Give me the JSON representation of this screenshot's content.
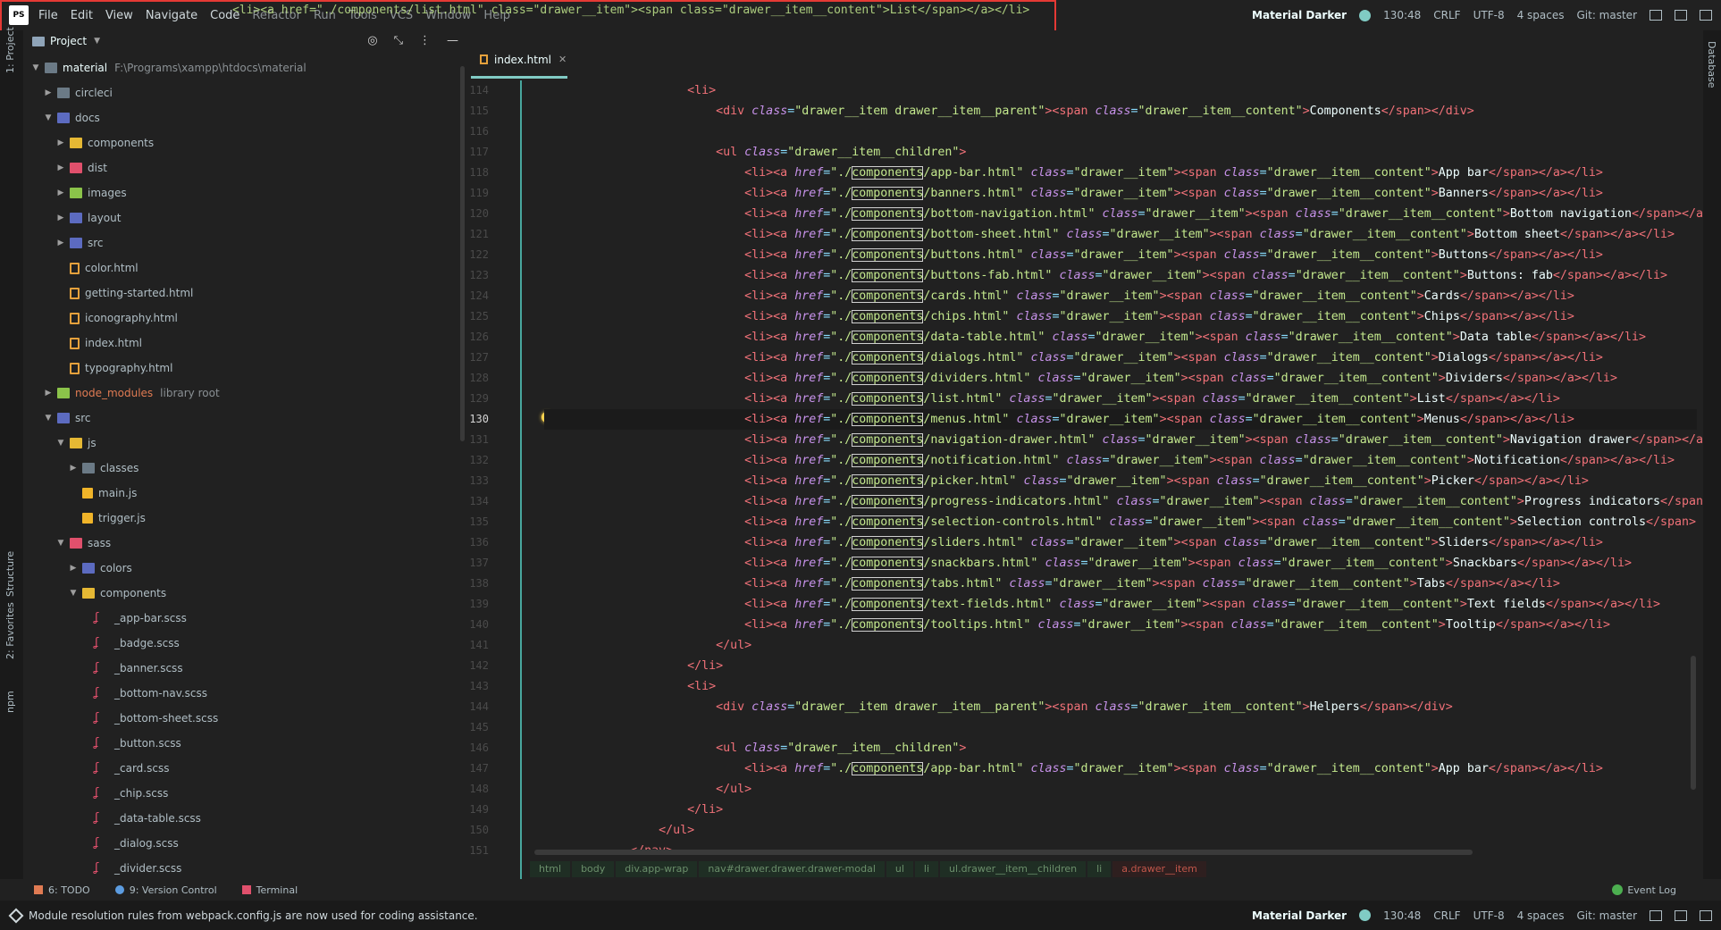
{
  "menu": {
    "logo": "PS",
    "items": [
      "File",
      "Edit",
      "View",
      "Navigate",
      "Code",
      "Refactor",
      "Run",
      "Tools",
      "VCS",
      "Window",
      "Help"
    ]
  },
  "top_status": {
    "theme": "Material Darker",
    "position": "130:48",
    "line_ending": "CRLF",
    "encoding": "UTF-8",
    "indent": "4 spaces",
    "vcs": "Git: master"
  },
  "sidebar_tabs": {
    "project": "1: Project",
    "structure": "Structure",
    "favorites": "2: Favorites",
    "npm": "npm",
    "database": "Database"
  },
  "project_panel": {
    "title": "Project",
    "tree": [
      {
        "indent": 0,
        "arrow": "down",
        "icon": "folder",
        "color": "gray",
        "name": "material",
        "bright": true,
        "path": "F:\\Programs\\xampp\\htdocs\\material"
      },
      {
        "indent": 1,
        "arrow": "right",
        "icon": "folder",
        "color": "gray",
        "name": "circleci"
      },
      {
        "indent": 1,
        "arrow": "down",
        "icon": "folder",
        "color": "blue",
        "name": "docs"
      },
      {
        "indent": 2,
        "arrow": "right",
        "icon": "folder",
        "color": "yellow",
        "name": "components"
      },
      {
        "indent": 2,
        "arrow": "right",
        "icon": "folder",
        "color": "red",
        "name": "dist"
      },
      {
        "indent": 2,
        "arrow": "right",
        "icon": "folder",
        "color": "green",
        "name": "images"
      },
      {
        "indent": 2,
        "arrow": "right",
        "icon": "folder",
        "color": "blue",
        "name": "layout"
      },
      {
        "indent": 2,
        "arrow": "right",
        "icon": "folder",
        "color": "blue",
        "name": "src"
      },
      {
        "indent": 2,
        "arrow": "none",
        "icon": "html",
        "name": "color.html"
      },
      {
        "indent": 2,
        "arrow": "none",
        "icon": "html",
        "name": "getting-started.html"
      },
      {
        "indent": 2,
        "arrow": "none",
        "icon": "html",
        "name": "iconography.html"
      },
      {
        "indent": 2,
        "arrow": "none",
        "icon": "html",
        "name": "index.html"
      },
      {
        "indent": 2,
        "arrow": "none",
        "icon": "html",
        "name": "typography.html"
      },
      {
        "indent": 1,
        "arrow": "right",
        "icon": "folder",
        "color": "green",
        "name": "node_modules",
        "hl": true,
        "path": "library root"
      },
      {
        "indent": 1,
        "arrow": "down",
        "icon": "folder",
        "color": "blue",
        "name": "src"
      },
      {
        "indent": 2,
        "arrow": "down",
        "icon": "folder",
        "color": "yellow",
        "name": "js"
      },
      {
        "indent": 3,
        "arrow": "right",
        "icon": "folder",
        "color": "gray",
        "name": "classes"
      },
      {
        "indent": 3,
        "arrow": "none",
        "icon": "js",
        "name": "main.js"
      },
      {
        "indent": 3,
        "arrow": "none",
        "icon": "js",
        "name": "trigger.js"
      },
      {
        "indent": 2,
        "arrow": "down",
        "icon": "folder",
        "color": "red",
        "name": "sass"
      },
      {
        "indent": 3,
        "arrow": "right",
        "icon": "folder",
        "color": "blue",
        "name": "colors"
      },
      {
        "indent": 3,
        "arrow": "down",
        "icon": "folder",
        "color": "yellow",
        "name": "components"
      },
      {
        "indent": 4,
        "arrow": "none",
        "icon": "scss",
        "name": "_app-bar.scss"
      },
      {
        "indent": 4,
        "arrow": "none",
        "icon": "scss",
        "name": "_badge.scss"
      },
      {
        "indent": 4,
        "arrow": "none",
        "icon": "scss",
        "name": "_banner.scss"
      },
      {
        "indent": 4,
        "arrow": "none",
        "icon": "scss",
        "name": "_bottom-nav.scss"
      },
      {
        "indent": 4,
        "arrow": "none",
        "icon": "scss",
        "name": "_bottom-sheet.scss"
      },
      {
        "indent": 4,
        "arrow": "none",
        "icon": "scss",
        "name": "_button.scss"
      },
      {
        "indent": 4,
        "arrow": "none",
        "icon": "scss",
        "name": "_card.scss"
      },
      {
        "indent": 4,
        "arrow": "none",
        "icon": "scss",
        "name": "_chip.scss"
      },
      {
        "indent": 4,
        "arrow": "none",
        "icon": "scss",
        "name": "_data-table.scss"
      },
      {
        "indent": 4,
        "arrow": "none",
        "icon": "scss",
        "name": "_dialog.scss"
      },
      {
        "indent": 4,
        "arrow": "none",
        "icon": "scss",
        "name": "_divider.scss"
      }
    ]
  },
  "editor": {
    "tab": "index.html",
    "current_line": 130,
    "menu_overlay": "<li><a href=\"./components/list.html\" class=\"drawer__item\"><span class=\"drawer__item__content\">List</span></a></li>",
    "lines": [
      {
        "n": 114,
        "indent": 2,
        "segs": [
          [
            "tag",
            "<li>"
          ]
        ]
      },
      {
        "n": 115,
        "indent": 3,
        "segs": [
          [
            "tag",
            "<div "
          ],
          [
            "attr",
            "class"
          ],
          [
            "eq",
            "="
          ],
          [
            "str",
            "\"drawer__item drawer__item__parent\""
          ],
          [
            "tag",
            "><span "
          ],
          [
            "attr",
            "class"
          ],
          [
            "eq",
            "="
          ],
          [
            "str",
            "\"drawer__item__content\""
          ],
          [
            "tag",
            ">"
          ],
          [
            "txt",
            "Components"
          ],
          [
            "tag",
            "</span></div>"
          ]
        ]
      },
      {
        "n": 116,
        "indent": 0,
        "segs": []
      },
      {
        "n": 117,
        "indent": 3,
        "segs": [
          [
            "tag",
            "<ul "
          ],
          [
            "attr",
            "class"
          ],
          [
            "eq",
            "="
          ],
          [
            "str",
            "\"drawer__item__children\""
          ],
          [
            "tag",
            ">"
          ]
        ]
      },
      {
        "n": 118,
        "indent": 4,
        "link": "app-bar.html",
        "label": "App bar"
      },
      {
        "n": 119,
        "indent": 4,
        "link": "banners.html",
        "label": "Banners"
      },
      {
        "n": 120,
        "indent": 4,
        "link": "bottom-navigation.html",
        "label": "Bottom navigation",
        "tail": "</span></a>"
      },
      {
        "n": 121,
        "indent": 4,
        "link": "bottom-sheet.html",
        "label": "Bottom sheet"
      },
      {
        "n": 122,
        "indent": 4,
        "link": "buttons.html",
        "label": "Buttons"
      },
      {
        "n": 123,
        "indent": 4,
        "link": "buttons-fab.html",
        "label": "Buttons: fab"
      },
      {
        "n": 124,
        "indent": 4,
        "link": "cards.html",
        "label": "Cards"
      },
      {
        "n": 125,
        "indent": 4,
        "link": "chips.html",
        "label": "Chips"
      },
      {
        "n": 126,
        "indent": 4,
        "link": "data-table.html",
        "label": "Data table"
      },
      {
        "n": 127,
        "indent": 4,
        "link": "dialogs.html",
        "label": "Dialogs"
      },
      {
        "n": 128,
        "indent": 4,
        "link": "dividers.html",
        "label": "Dividers"
      },
      {
        "n": 129,
        "indent": 4,
        "link": "list.html",
        "label": "List"
      },
      {
        "n": 130,
        "indent": 4,
        "link": "menus.html",
        "label": "Menus"
      },
      {
        "n": 131,
        "indent": 4,
        "link": "navigation-drawer.html",
        "label": "Navigation drawer",
        "tail": "</span></a>"
      },
      {
        "n": 132,
        "indent": 4,
        "link": "notification.html",
        "label": "Notification"
      },
      {
        "n": 133,
        "indent": 4,
        "link": "picker.html",
        "label": "Picker"
      },
      {
        "n": 134,
        "indent": 4,
        "link": "progress-indicators.html",
        "label": "Progress indicators",
        "tail": "</span>"
      },
      {
        "n": 135,
        "indent": 4,
        "link": "selection-controls.html",
        "label": "Selection controls",
        "tail": "</span>"
      },
      {
        "n": 136,
        "indent": 4,
        "link": "sliders.html",
        "label": "Sliders"
      },
      {
        "n": 137,
        "indent": 4,
        "link": "snackbars.html",
        "label": "Snackbars"
      },
      {
        "n": 138,
        "indent": 4,
        "link": "tabs.html",
        "label": "Tabs"
      },
      {
        "n": 139,
        "indent": 4,
        "link": "text-fields.html",
        "label": "Text fields"
      },
      {
        "n": 140,
        "indent": 4,
        "link": "tooltips.html",
        "label": "Tooltip"
      },
      {
        "n": 141,
        "indent": 3,
        "segs": [
          [
            "tag",
            "</ul>"
          ]
        ]
      },
      {
        "n": 142,
        "indent": 2,
        "segs": [
          [
            "tag",
            "</li>"
          ]
        ]
      },
      {
        "n": 143,
        "indent": 2,
        "segs": [
          [
            "tag",
            "<li>"
          ]
        ]
      },
      {
        "n": 144,
        "indent": 3,
        "segs": [
          [
            "tag",
            "<div "
          ],
          [
            "attr",
            "class"
          ],
          [
            "eq",
            "="
          ],
          [
            "str",
            "\"drawer__item drawer__item__parent\""
          ],
          [
            "tag",
            "><span "
          ],
          [
            "attr",
            "class"
          ],
          [
            "eq",
            "="
          ],
          [
            "str",
            "\"drawer__item__content\""
          ],
          [
            "tag",
            ">"
          ],
          [
            "txt",
            "Helpers"
          ],
          [
            "tag",
            "</span></div>"
          ]
        ]
      },
      {
        "n": 145,
        "indent": 0,
        "segs": []
      },
      {
        "n": 146,
        "indent": 3,
        "segs": [
          [
            "tag",
            "<ul "
          ],
          [
            "attr",
            "class"
          ],
          [
            "eq",
            "="
          ],
          [
            "str",
            "\"drawer__item__children\""
          ],
          [
            "tag",
            ">"
          ]
        ]
      },
      {
        "n": 147,
        "indent": 4,
        "link": "app-bar.html",
        "label": "App bar"
      },
      {
        "n": 148,
        "indent": 3,
        "segs": [
          [
            "tag",
            "</ul>"
          ]
        ]
      },
      {
        "n": 149,
        "indent": 2,
        "segs": [
          [
            "tag",
            "</li>"
          ]
        ]
      },
      {
        "n": 150,
        "indent": 1,
        "segs": [
          [
            "tag",
            "</ul>"
          ]
        ]
      },
      {
        "n": 151,
        "indent": 0,
        "segs": [
          [
            "tag",
            "</nav>"
          ]
        ]
      }
    ],
    "breadcrumb": [
      "html",
      "body",
      "div.app-wrap",
      "nav#drawer.drawer.drawer-modal",
      "ul",
      "li",
      "ul.drawer__item__children",
      "li",
      "a.drawer__item"
    ]
  },
  "bottom_tools": {
    "todo": "6: TODO",
    "vcs": "9: Version Control",
    "terminal": "Terminal",
    "event_log": "Event Log"
  },
  "status_bar": {
    "message": "Module resolution rules from webpack.config.js are now used for coding assistance.",
    "theme": "Material Darker",
    "position": "130:48",
    "line_ending": "CRLF",
    "encoding": "UTF-8",
    "indent": "4 spaces",
    "vcs": "Git: master"
  },
  "colors": {
    "tag": "#f07178",
    "attr": "#c792ea",
    "string": "#c3e88d",
    "accent": "#80cbc4"
  }
}
